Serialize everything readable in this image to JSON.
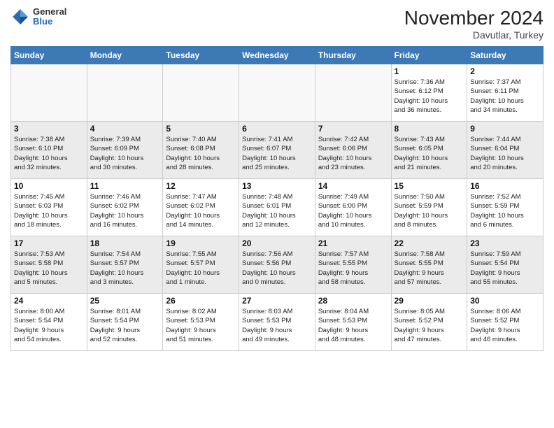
{
  "header": {
    "logo_general": "General",
    "logo_blue": "Blue",
    "month_year": "November 2024",
    "location": "Davutlar, Turkey"
  },
  "weekdays": [
    "Sunday",
    "Monday",
    "Tuesday",
    "Wednesday",
    "Thursday",
    "Friday",
    "Saturday"
  ],
  "weeks": [
    {
      "shaded": false,
      "days": [
        {
          "num": "",
          "info": ""
        },
        {
          "num": "",
          "info": ""
        },
        {
          "num": "",
          "info": ""
        },
        {
          "num": "",
          "info": ""
        },
        {
          "num": "",
          "info": ""
        },
        {
          "num": "1",
          "info": "Sunrise: 7:36 AM\nSunset: 6:12 PM\nDaylight: 10 hours\nand 36 minutes."
        },
        {
          "num": "2",
          "info": "Sunrise: 7:37 AM\nSunset: 6:11 PM\nDaylight: 10 hours\nand 34 minutes."
        }
      ]
    },
    {
      "shaded": true,
      "days": [
        {
          "num": "3",
          "info": "Sunrise: 7:38 AM\nSunset: 6:10 PM\nDaylight: 10 hours\nand 32 minutes."
        },
        {
          "num": "4",
          "info": "Sunrise: 7:39 AM\nSunset: 6:09 PM\nDaylight: 10 hours\nand 30 minutes."
        },
        {
          "num": "5",
          "info": "Sunrise: 7:40 AM\nSunset: 6:08 PM\nDaylight: 10 hours\nand 28 minutes."
        },
        {
          "num": "6",
          "info": "Sunrise: 7:41 AM\nSunset: 6:07 PM\nDaylight: 10 hours\nand 25 minutes."
        },
        {
          "num": "7",
          "info": "Sunrise: 7:42 AM\nSunset: 6:06 PM\nDaylight: 10 hours\nand 23 minutes."
        },
        {
          "num": "8",
          "info": "Sunrise: 7:43 AM\nSunset: 6:05 PM\nDaylight: 10 hours\nand 21 minutes."
        },
        {
          "num": "9",
          "info": "Sunrise: 7:44 AM\nSunset: 6:04 PM\nDaylight: 10 hours\nand 20 minutes."
        }
      ]
    },
    {
      "shaded": false,
      "days": [
        {
          "num": "10",
          "info": "Sunrise: 7:45 AM\nSunset: 6:03 PM\nDaylight: 10 hours\nand 18 minutes."
        },
        {
          "num": "11",
          "info": "Sunrise: 7:46 AM\nSunset: 6:02 PM\nDaylight: 10 hours\nand 16 minutes."
        },
        {
          "num": "12",
          "info": "Sunrise: 7:47 AM\nSunset: 6:02 PM\nDaylight: 10 hours\nand 14 minutes."
        },
        {
          "num": "13",
          "info": "Sunrise: 7:48 AM\nSunset: 6:01 PM\nDaylight: 10 hours\nand 12 minutes."
        },
        {
          "num": "14",
          "info": "Sunrise: 7:49 AM\nSunset: 6:00 PM\nDaylight: 10 hours\nand 10 minutes."
        },
        {
          "num": "15",
          "info": "Sunrise: 7:50 AM\nSunset: 5:59 PM\nDaylight: 10 hours\nand 8 minutes."
        },
        {
          "num": "16",
          "info": "Sunrise: 7:52 AM\nSunset: 5:59 PM\nDaylight: 10 hours\nand 6 minutes."
        }
      ]
    },
    {
      "shaded": true,
      "days": [
        {
          "num": "17",
          "info": "Sunrise: 7:53 AM\nSunset: 5:58 PM\nDaylight: 10 hours\nand 5 minutes."
        },
        {
          "num": "18",
          "info": "Sunrise: 7:54 AM\nSunset: 5:57 PM\nDaylight: 10 hours\nand 3 minutes."
        },
        {
          "num": "19",
          "info": "Sunrise: 7:55 AM\nSunset: 5:57 PM\nDaylight: 10 hours\nand 1 minute."
        },
        {
          "num": "20",
          "info": "Sunrise: 7:56 AM\nSunset: 5:56 PM\nDaylight: 10 hours\nand 0 minutes."
        },
        {
          "num": "21",
          "info": "Sunrise: 7:57 AM\nSunset: 5:55 PM\nDaylight: 9 hours\nand 58 minutes."
        },
        {
          "num": "22",
          "info": "Sunrise: 7:58 AM\nSunset: 5:55 PM\nDaylight: 9 hours\nand 57 minutes."
        },
        {
          "num": "23",
          "info": "Sunrise: 7:59 AM\nSunset: 5:54 PM\nDaylight: 9 hours\nand 55 minutes."
        }
      ]
    },
    {
      "shaded": false,
      "days": [
        {
          "num": "24",
          "info": "Sunrise: 8:00 AM\nSunset: 5:54 PM\nDaylight: 9 hours\nand 54 minutes."
        },
        {
          "num": "25",
          "info": "Sunrise: 8:01 AM\nSunset: 5:54 PM\nDaylight: 9 hours\nand 52 minutes."
        },
        {
          "num": "26",
          "info": "Sunrise: 8:02 AM\nSunset: 5:53 PM\nDaylight: 9 hours\nand 51 minutes."
        },
        {
          "num": "27",
          "info": "Sunrise: 8:03 AM\nSunset: 5:53 PM\nDaylight: 9 hours\nand 49 minutes."
        },
        {
          "num": "28",
          "info": "Sunrise: 8:04 AM\nSunset: 5:53 PM\nDaylight: 9 hours\nand 48 minutes."
        },
        {
          "num": "29",
          "info": "Sunrise: 8:05 AM\nSunset: 5:52 PM\nDaylight: 9 hours\nand 47 minutes."
        },
        {
          "num": "30",
          "info": "Sunrise: 8:06 AM\nSunset: 5:52 PM\nDaylight: 9 hours\nand 46 minutes."
        }
      ]
    }
  ]
}
